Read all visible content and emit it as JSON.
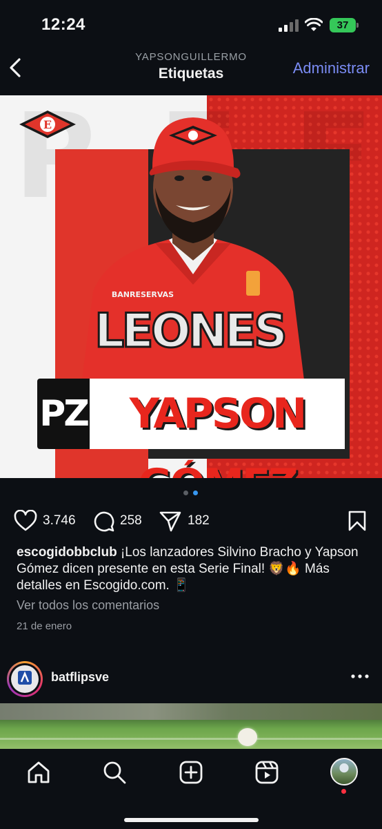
{
  "status_bar": {
    "time": "12:24",
    "battery": "37"
  },
  "header": {
    "account": "YAPSONGUILLERMO",
    "title": "Etiquetas",
    "manage_label": "Administrar"
  },
  "post": {
    "image": {
      "team_name": "LEONES",
      "sponsor": "BANRESERVAS",
      "position": "PZ",
      "player_name": "YAPSON GÓMEZ",
      "logo_letter": "E"
    },
    "carousel": {
      "count": 2,
      "active_index": 1
    },
    "likes": "3.746",
    "comments": "258",
    "shares": "182",
    "caption_user": "escogidobbclub",
    "caption_text": " ¡Los lanzadores Silvino Bracho y Yapson Gómez dicen presente en esta Serie Final! 🦁🔥 Más detalles en Escogido.com. 📱",
    "view_comments": "Ver todos los comentarios",
    "date": "21 de enero"
  },
  "next_post": {
    "username": "batflipsve"
  },
  "tab_bar": {
    "items": [
      "home-icon",
      "search-icon",
      "create-icon",
      "reels-icon",
      "profile-avatar"
    ],
    "notification_dot": true
  },
  "colors": {
    "background": "#0c0f14",
    "accent_link": "#7b8cf5",
    "team_red": "#e8261d",
    "active_dot": "#3897f0"
  }
}
